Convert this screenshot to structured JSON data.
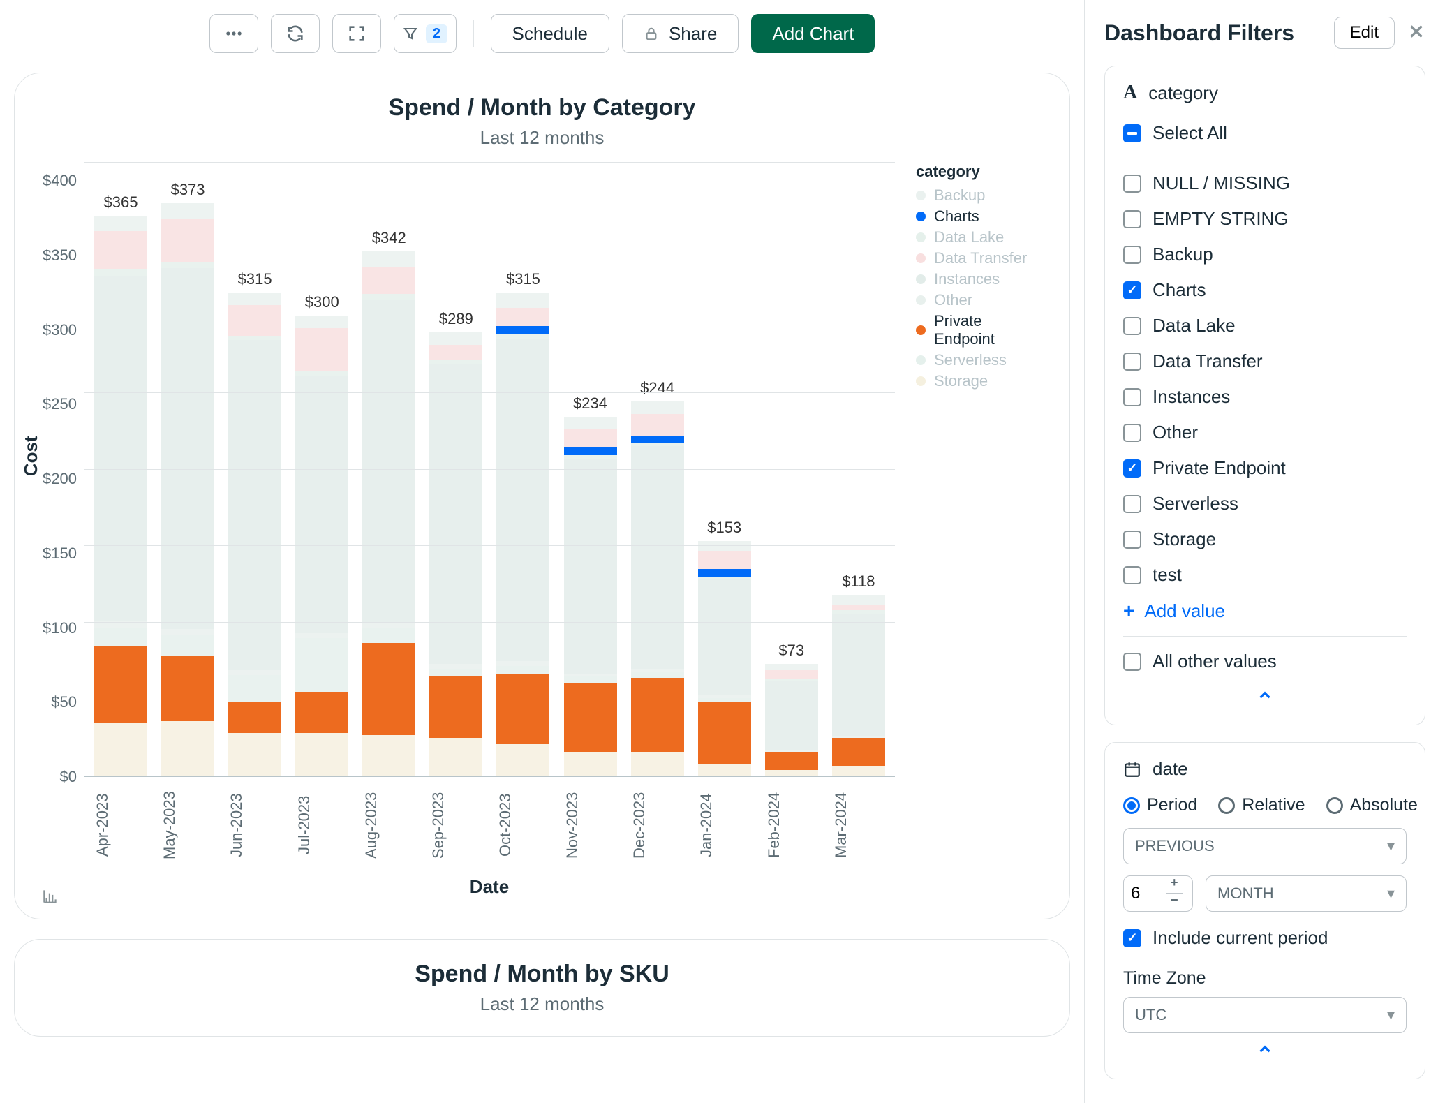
{
  "toolbar": {
    "filter_count": "2",
    "schedule": "Schedule",
    "share": "Share",
    "add_chart": "Add Chart"
  },
  "cards": [
    {
      "title": "Spend / Month by Category",
      "subtitle": "Last 12 months",
      "ylabel": "Cost",
      "xlabel": "Date",
      "legend_title": "category"
    },
    {
      "title": "Spend / Month by SKU",
      "subtitle": "Last 12 months"
    }
  ],
  "chart_data": {
    "type": "bar",
    "stacked": true,
    "title": "Spend / Month by Category",
    "subtitle": "Last 12 months",
    "xlabel": "Date",
    "ylabel": "Cost",
    "ylim": [
      0,
      400
    ],
    "yticks": [
      0,
      50,
      100,
      150,
      200,
      250,
      300,
      350,
      400
    ],
    "legend_title": "category",
    "categories": [
      "Apr-2023",
      "May-2023",
      "Jun-2023",
      "Jul-2023",
      "Aug-2023",
      "Sep-2023",
      "Oct-2023",
      "Nov-2023",
      "Dec-2023",
      "Jan-2024",
      "Feb-2024",
      "Mar-2024"
    ],
    "totals": [
      365,
      373,
      315,
      300,
      342,
      289,
      315,
      234,
      244,
      153,
      73,
      118
    ],
    "series": [
      {
        "name": "Backup",
        "color": "#dce7e4",
        "highlighted": false,
        "values": [
          10,
          10,
          8,
          8,
          10,
          8,
          10,
          8,
          8,
          6,
          4,
          6
        ]
      },
      {
        "name": "Charts",
        "color": "#016bf8",
        "highlighted": true,
        "values": [
          0,
          0,
          0,
          0,
          0,
          0,
          5,
          5,
          5,
          5,
          0,
          0
        ]
      },
      {
        "name": "Data Lake",
        "color": "#d3e6de",
        "highlighted": false,
        "values": [
          4,
          4,
          3,
          3,
          4,
          3,
          3,
          2,
          2,
          2,
          1,
          2
        ]
      },
      {
        "name": "Data Transfer",
        "color": "#f3c9c9",
        "highlighted": false,
        "values": [
          25,
          28,
          20,
          28,
          18,
          10,
          12,
          12,
          14,
          12,
          6,
          4
        ]
      },
      {
        "name": "Instances",
        "color": "#cfe0db",
        "highlighted": false,
        "values": [
          225,
          235,
          215,
          168,
          210,
          195,
          210,
          140,
          145,
          75,
          45,
          80
        ]
      },
      {
        "name": "Other",
        "color": "#d9e6e1",
        "highlighted": false,
        "values": [
          4,
          4,
          3,
          3,
          3,
          3,
          3,
          2,
          2,
          2,
          1,
          1
        ]
      },
      {
        "name": "Private Endpoint",
        "color": "#ed6b1f",
        "highlighted": true,
        "values": [
          50,
          42,
          20,
          27,
          60,
          40,
          46,
          45,
          48,
          40,
          12,
          18
        ]
      },
      {
        "name": "Serverless",
        "color": "#d4e6e0",
        "highlighted": false,
        "values": [
          12,
          14,
          18,
          35,
          10,
          5,
          5,
          4,
          4,
          3,
          0,
          0
        ]
      },
      {
        "name": "Storage",
        "color": "#efe6ca",
        "highlighted": false,
        "values": [
          35,
          36,
          28,
          28,
          27,
          25,
          21,
          16,
          16,
          8,
          4,
          7
        ]
      }
    ],
    "stack_order": [
      "Storage",
      "Private Endpoint",
      "Serverless",
      "Other",
      "Instances",
      "Data Lake",
      "Charts",
      "Data Transfer",
      "Backup"
    ],
    "highlighted_series": [
      "Charts",
      "Private Endpoint"
    ]
  },
  "side": {
    "title": "Dashboard Filters",
    "edit": "Edit",
    "filters": {
      "category": {
        "label": "category",
        "select_all": "Select All",
        "select_all_state": "indeterminate",
        "options": [
          {
            "label": "NULL / MISSING",
            "checked": false
          },
          {
            "label": "EMPTY STRING",
            "checked": false
          },
          {
            "label": "Backup",
            "checked": false
          },
          {
            "label": "Charts",
            "checked": true
          },
          {
            "label": "Data Lake",
            "checked": false
          },
          {
            "label": "Data Transfer",
            "checked": false
          },
          {
            "label": "Instances",
            "checked": false
          },
          {
            "label": "Other",
            "checked": false
          },
          {
            "label": "Private Endpoint",
            "checked": true
          },
          {
            "label": "Serverless",
            "checked": false
          },
          {
            "label": "Storage",
            "checked": false
          },
          {
            "label": "test",
            "checked": false
          }
        ],
        "add_value": "Add value",
        "all_other": "All other values"
      },
      "date": {
        "label": "date",
        "modes": [
          {
            "label": "Period",
            "selected": true
          },
          {
            "label": "Relative",
            "selected": false
          },
          {
            "label": "Absolute",
            "selected": false
          }
        ],
        "direction": "PREVIOUS",
        "count": "6",
        "unit": "MONTH",
        "include_current": {
          "label": "Include current period",
          "checked": true
        },
        "timezone_label": "Time Zone",
        "timezone": "UTC"
      }
    }
  }
}
